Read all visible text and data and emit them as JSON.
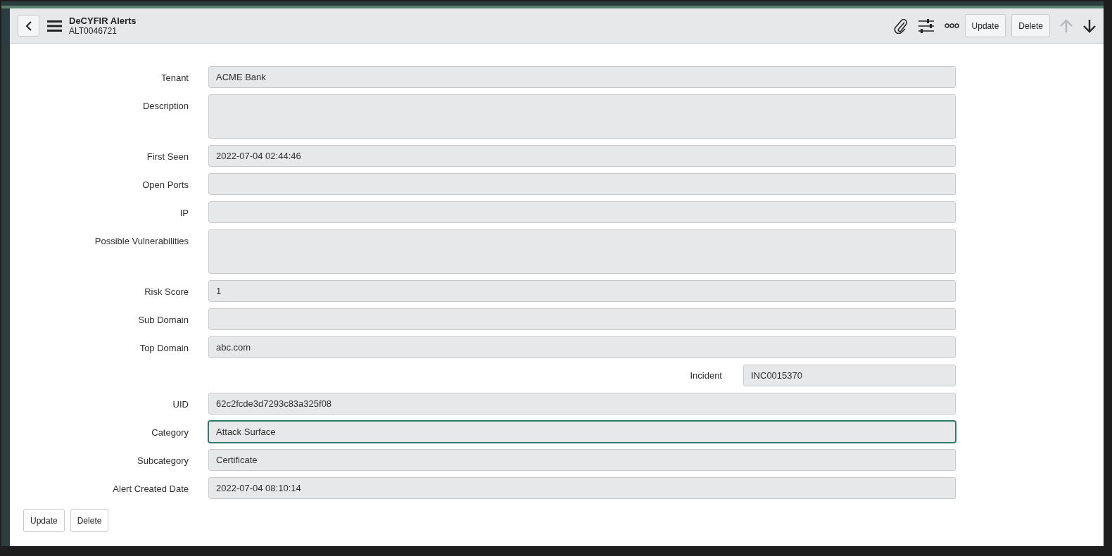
{
  "header": {
    "title": "DeCYFIR Alerts",
    "record": "ALT0046721",
    "buttons": [
      "Update",
      "Delete"
    ],
    "next_enabled": true,
    "prev_enabled": false
  },
  "fields": [
    {
      "label": "Tenant",
      "value": "ACME Bank",
      "kind": "input",
      "focused": false
    },
    {
      "label": "Description",
      "kind": "textarea",
      "focused": false
    },
    {
      "label": "First Seen",
      "value": "2022-07-04 02:44:46",
      "kind": "input",
      "focused": false
    },
    {
      "label": "Open Ports",
      "kind": "input",
      "focused": false
    },
    {
      "label": "IP",
      "kind": "input",
      "focused": false
    },
    {
      "label": "Possible Vulnerabilities",
      "kind": "textarea",
      "focused": false
    },
    {
      "label": "Risk Score",
      "value": "1",
      "kind": "input",
      "focused": false
    },
    {
      "label": "Sub Domain",
      "kind": "input",
      "focused": false
    },
    {
      "label": "Top Domain",
      "value": "abc.com",
      "kind": "input",
      "focused": false
    },
    {
      "label": "Incident",
      "value": "INC0015370",
      "kind": "split",
      "focused": false
    },
    {
      "label": "UID",
      "value": "62c2fcde3d7293c83a325f08",
      "kind": "input",
      "focused": false
    },
    {
      "label": "Category",
      "value": "Attack Surface",
      "kind": "input",
      "focused": true
    },
    {
      "label": "Subcategory",
      "value": "Certificate",
      "kind": "input",
      "focused": false
    },
    {
      "label": "Alert Created Date",
      "value": "2022-07-04 08:10:14",
      "kind": "input",
      "focused": false
    }
  ],
  "footer_buttons": [
    "Update",
    "Delete"
  ]
}
